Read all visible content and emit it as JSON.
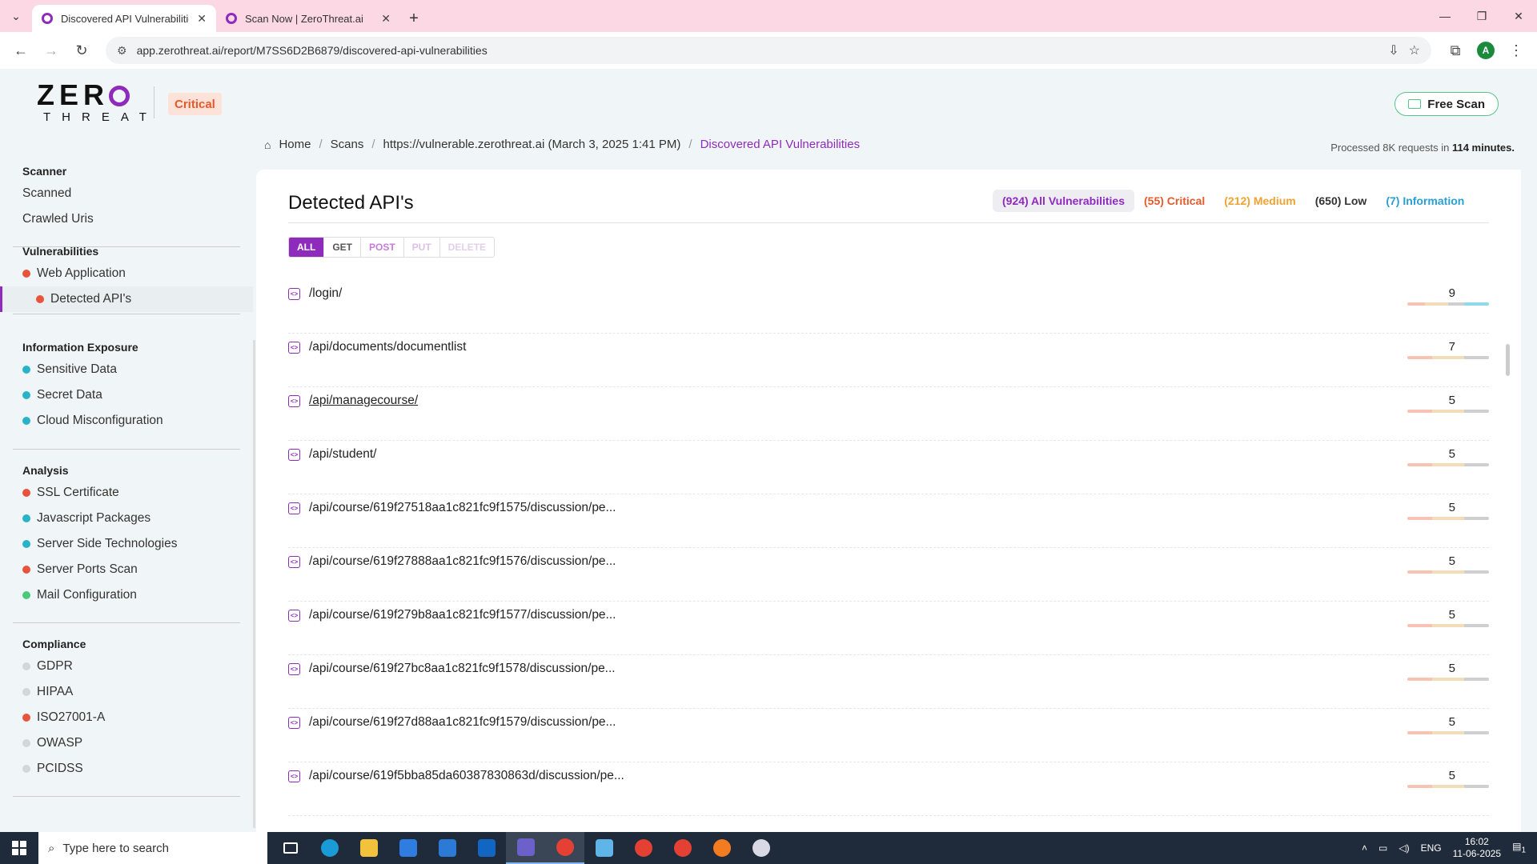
{
  "browser": {
    "tabs": [
      {
        "title": "Discovered API Vulnerabilities |",
        "active": true
      },
      {
        "title": "Scan Now | ZeroThreat.ai",
        "active": false
      }
    ],
    "url": "app.zerothreat.ai/report/M7SS6D2B6879/discovered-api-vulnerabilities",
    "profile_initial": "A"
  },
  "header": {
    "logo_top": "ZER",
    "logo_bottom": "THREAT",
    "severity_badge": "Critical",
    "free_scan_label": "Free Scan"
  },
  "breadcrumb": {
    "home": "Home",
    "scans": "Scans",
    "scan": "https://vulnerable.zerothreat.ai (March 3, 2025 1:41 PM)",
    "current": "Discovered API Vulnerabilities"
  },
  "processed": {
    "prefix": "Processed 8K requests in",
    "duration": "114 minutes."
  },
  "sidebar": {
    "scanner": {
      "heading": "Scanner",
      "items": [
        "Scanned",
        "Crawled Uris"
      ]
    },
    "vulnerabilities": {
      "heading": "Vulnerabilities",
      "items": [
        {
          "label": "Web Application",
          "color": "#e8533b"
        },
        {
          "label": "Detected API's",
          "color": "#e8533b"
        }
      ]
    },
    "information_exposure": {
      "heading": "Information Exposure",
      "items": [
        {
          "label": "Sensitive Data",
          "color": "#28b4c8"
        },
        {
          "label": "Secret Data",
          "color": "#28b4c8"
        },
        {
          "label": "Cloud Misconfiguration",
          "color": "#28b4c8"
        }
      ]
    },
    "analysis": {
      "heading": "Analysis",
      "items": [
        {
          "label": "SSL Certificate",
          "color": "#e8533b"
        },
        {
          "label": "Javascript Packages",
          "color": "#28b4c8"
        },
        {
          "label": "Server Side Technologies",
          "color": "#28b4c8"
        },
        {
          "label": "Server Ports Scan",
          "color": "#e8533b"
        },
        {
          "label": "Mail Configuration",
          "color": "#4ec97a"
        }
      ]
    },
    "compliance": {
      "heading": "Compliance",
      "items": [
        {
          "label": "GDPR",
          "color": "#d6d6d6"
        },
        {
          "label": "HIPAA",
          "color": "#d6d6d6"
        },
        {
          "label": "ISO27001-A",
          "color": "#e8533b"
        },
        {
          "label": "OWASP",
          "color": "#d6d6d6"
        },
        {
          "label": "PCIDSS",
          "color": "#d6d6d6"
        }
      ]
    }
  },
  "main": {
    "title": "Detected API's",
    "severity_filters": {
      "all": "(924) All Vulnerabilities",
      "critical": "(55) Critical",
      "medium": "(212) Medium",
      "low": "(650) Low",
      "info": "(7) Information"
    },
    "methods": [
      "ALL",
      "GET",
      "POST",
      "PUT",
      "DELETE"
    ],
    "apis": [
      {
        "path": "/login/",
        "count": "9",
        "split": [
          0.22,
          0.28,
          0.2,
          0.3
        ]
      },
      {
        "path": "/api/documents/documentlist",
        "count": "7",
        "split": [
          0.3,
          0.4,
          0.3,
          0
        ]
      },
      {
        "path": "/api/managecourse/",
        "count": "5",
        "split": [
          0.3,
          0.4,
          0.3,
          0
        ]
      },
      {
        "path": "/api/student/",
        "count": "5",
        "split": [
          0.3,
          0.4,
          0.3,
          0
        ]
      },
      {
        "path": "/api/course/619f27518aa1c821fc9f1575/discussion/pe...",
        "count": "5",
        "split": [
          0.3,
          0.4,
          0.3,
          0
        ]
      },
      {
        "path": "/api/course/619f27888aa1c821fc9f1576/discussion/pe...",
        "count": "5",
        "split": [
          0.3,
          0.4,
          0.3,
          0
        ]
      },
      {
        "path": "/api/course/619f279b8aa1c821fc9f1577/discussion/pe...",
        "count": "5",
        "split": [
          0.3,
          0.4,
          0.3,
          0
        ]
      },
      {
        "path": "/api/course/619f27bc8aa1c821fc9f1578/discussion/pe...",
        "count": "5",
        "split": [
          0.3,
          0.4,
          0.3,
          0
        ]
      },
      {
        "path": "/api/course/619f27d88aa1c821fc9f1579/discussion/pe...",
        "count": "5",
        "split": [
          0.3,
          0.4,
          0.3,
          0
        ]
      },
      {
        "path": "/api/course/619f5bba85da60387830863d/discussion/pe...",
        "count": "5",
        "split": [
          0.3,
          0.4,
          0.3,
          0
        ]
      }
    ]
  },
  "taskbar": {
    "search_placeholder": "Type here to search",
    "language": "ENG",
    "time": "16:02",
    "date": "11-06-2025",
    "notif_count": "1"
  },
  "colors": {
    "accent": "#8e2bbd",
    "critical": "#e55a2b",
    "medium": "#f0a232",
    "info": "#2a9fd4"
  }
}
